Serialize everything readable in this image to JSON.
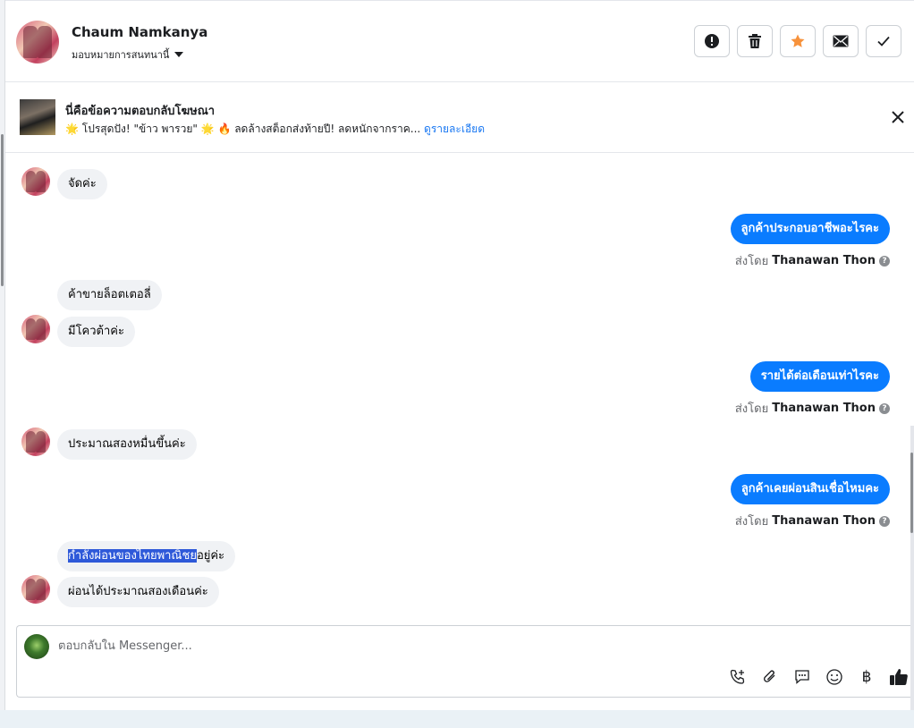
{
  "header": {
    "contact_name": "Chaum Namkanya",
    "assign_label": "มอบหมายการสนทนานี้"
  },
  "actions": {
    "spam_icon": "exclamation-circle-icon",
    "delete_icon": "trash-icon",
    "star_icon": "star-icon",
    "mail_icon": "envelope-icon",
    "done_icon": "check-icon",
    "star_color": "#f7923b"
  },
  "ad": {
    "title": "นี่คือข้อความตอบกลับโฆษณา",
    "description": "🌟 โปรสุดปัง! \"ข้าว พารวย\" 🌟 🔥 ลดล้างสต็อกส่งท้ายปี! ลดหนักจากราค...",
    "more_link": "ดูรายละเอียด"
  },
  "messages": {
    "m1": "จัดค่ะ",
    "m2": "ลูกค้าประกอบอาชีพอะไรคะ",
    "m3": "ค้าขายล็อตเตอลี่",
    "m4": "มีโควต้าค่ะ",
    "m5": "รายได้ต่อเดือนเท่าไรคะ",
    "m6": "ประมาณสองหมื่นขึ้นค่ะ",
    "m7": "ลูกค้าเคยผ่อนสินเชื่อไหมคะ",
    "m8_selected": "กำลังผ่อนของไทยพาณิชย",
    "m8_rest": "อยู่ค่ะ",
    "m9": "ผ่อนได้ประมาณสองเดือนค่ะ"
  },
  "sent_by": {
    "prefix": "ส่งโดย",
    "agent": "Thanawan Thon"
  },
  "composer": {
    "placeholder": "ตอบกลับใน Messenger...",
    "baht": "฿"
  },
  "colors": {
    "outgoing_bubble": "#0a7cff",
    "incoming_bubble": "#f0f2f5",
    "link": "#1877f2"
  }
}
